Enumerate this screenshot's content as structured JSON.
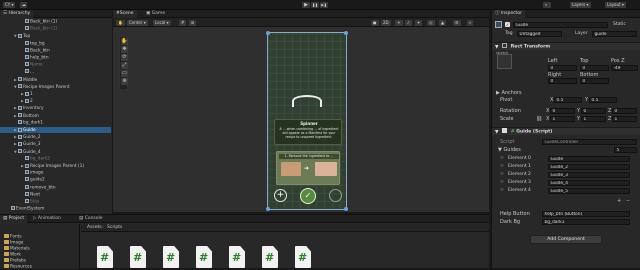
{
  "toolbar": {
    "account": "CY",
    "layers_label": "Layers",
    "layout_label": "Layout",
    "play_glyph": "▶",
    "pause_glyph": "❚❚",
    "step_glyph": "▶❚"
  },
  "hierarchy": {
    "tab_label": "Hierarchy",
    "rows": [
      {
        "label": "Back_btn (1)",
        "indent": 3,
        "dim": false,
        "arrow": ""
      },
      {
        "label": "Back_btn (1)",
        "indent": 3,
        "dim": true,
        "arrow": ""
      },
      {
        "label": "Top",
        "indent": 2,
        "dim": false,
        "arrow": "▼"
      },
      {
        "label": "top_bg",
        "indent": 3,
        "dim": false,
        "arrow": ""
      },
      {
        "label": "Back_btn",
        "indent": 3,
        "dim": false,
        "arrow": ""
      },
      {
        "label": "help_btn",
        "indent": 3,
        "dim": false,
        "arrow": ""
      },
      {
        "label": "Name",
        "indent": 3,
        "dim": true,
        "arrow": ""
      },
      {
        "label": "...",
        "indent": 3,
        "dim": false,
        "arrow": ""
      },
      {
        "label": "Middle",
        "indent": 2,
        "dim": false,
        "arrow": "▶"
      },
      {
        "label": "Recipe Images Parent",
        "indent": 2,
        "dim": false,
        "arrow": "▼"
      },
      {
        "label": "1",
        "indent": 3,
        "dim": false,
        "arrow": "▶"
      },
      {
        "label": "2",
        "indent": 3,
        "dim": false,
        "arrow": "▶"
      },
      {
        "label": "Inventory",
        "indent": 2,
        "dim": false,
        "arrow": "▶"
      },
      {
        "label": "Bottom",
        "indent": 2,
        "dim": false,
        "arrow": "▶"
      },
      {
        "label": "bg_dark1",
        "indent": 2,
        "dim": false,
        "arrow": ""
      },
      {
        "label": "Guide",
        "indent": 2,
        "dim": false,
        "arrow": "▶",
        "selected": true
      },
      {
        "label": "Guide_2",
        "indent": 2,
        "dim": false,
        "arrow": "▶"
      },
      {
        "label": "Guide_3",
        "indent": 2,
        "dim": false,
        "arrow": "▶"
      },
      {
        "label": "Guide_4",
        "indent": 2,
        "dim": false,
        "arrow": "▼"
      },
      {
        "label": "bg_dark2",
        "indent": 3,
        "dim": true,
        "arrow": ""
      },
      {
        "label": "Recipe Images Parent (1)",
        "indent": 3,
        "dim": false,
        "arrow": "▶"
      },
      {
        "label": "image",
        "indent": 3,
        "dim": false,
        "arrow": ""
      },
      {
        "label": "guide2",
        "indent": 3,
        "dim": false,
        "arrow": ""
      },
      {
        "label": "remove_btn",
        "indent": 3,
        "dim": false,
        "arrow": ""
      },
      {
        "label": "Next",
        "indent": 3,
        "dim": false,
        "arrow": ""
      },
      {
        "label": "Skip",
        "indent": 3,
        "dim": true,
        "arrow": ""
      },
      {
        "label": "EventSystem",
        "indent": 1,
        "dim": false,
        "arrow": ""
      }
    ]
  },
  "scene": {
    "tab_scene": "Scene",
    "tab_game": "Game",
    "pivot_mode": "Center",
    "space_mode": "Local",
    "mode_2d": "2D"
  },
  "game_view": {
    "tooltip_title": "Spinner",
    "tooltip_text": "A ... when combining ... of ingredient will appear as a Manifest for your recipe to unspeed Ingredient.",
    "hint_text": "1. Remove the ingredient to ...",
    "add_glyph": "+",
    "check_glyph": "✓"
  },
  "project": {
    "tab_project": "Project",
    "tab_animation": "Animation",
    "tab_console": "Console",
    "breadcrumb": [
      "Assets",
      "Scripts"
    ],
    "folders": [
      "Fonts",
      "Image",
      "Materials",
      "Work",
      "Prefabs",
      "Resources"
    ],
    "script_glyph": "#"
  },
  "inspector": {
    "tab_label": "Inspector",
    "object_name": "Guide",
    "static_label": "Static",
    "tag_label": "Tag",
    "tag_value": "Untagged",
    "layer_label": "Layer",
    "layer_value": "guide",
    "rect_transform": {
      "title": "Rect Transform",
      "anchor_preset": "stretch",
      "left_label": "Left",
      "top_label": "Top",
      "posz_label": "Pos Z",
      "left": "0",
      "top": "0",
      "posz": "-49",
      "right_label": "Right",
      "bottom_label": "Bottom",
      "right": "0",
      "bottom": "0",
      "anchors_label": "Anchors",
      "pivot_label": "Pivot",
      "pivot_x": "0.5",
      "pivot_y": "0.5",
      "rotation_label": "Rotation",
      "rot_x": "0",
      "rot_y": "0",
      "rot_z": "0",
      "scale_label": "Scale",
      "scale_x": "1",
      "scale_y": "1",
      "scale_z": "1"
    },
    "guide_script": {
      "title": "Guide (Script)",
      "script_label": "Script",
      "script_value": "GuideController",
      "guides_label": "Guides",
      "guides_count": "5",
      "elements": [
        {
          "label": "Element 0",
          "value": "Guide"
        },
        {
          "label": "Element 1",
          "value": "Guide_2"
        },
        {
          "label": "Element 2",
          "value": "Guide_3"
        },
        {
          "label": "Element 3",
          "value": "Guide_4"
        },
        {
          "label": "Element 4",
          "value": "Guide_5"
        }
      ],
      "help_button_label": "Help Button",
      "help_button_value": "help_btn (Button)",
      "dark_bg_label": "Dark Bg",
      "dark_bg_value": "bg_dark1"
    },
    "add_component": "Add Component"
  }
}
